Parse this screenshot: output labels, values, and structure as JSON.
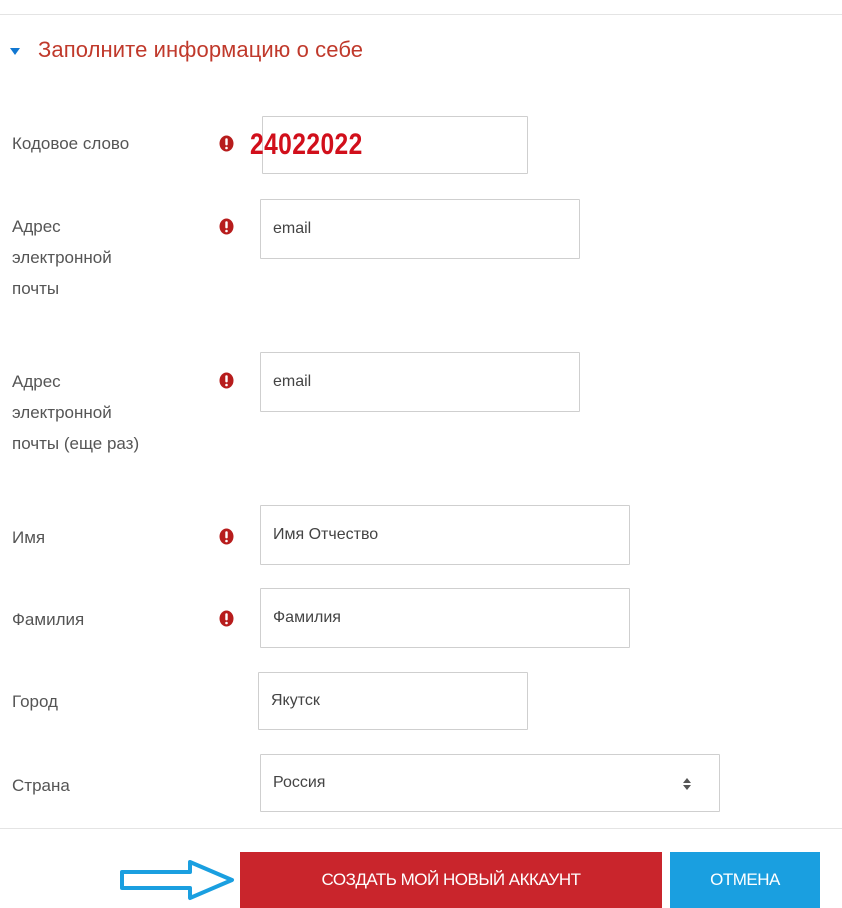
{
  "section": {
    "title": "Заполните информацию о себе"
  },
  "form": {
    "codeword": {
      "label": "Кодовое слово",
      "value": "24022022"
    },
    "email": {
      "label_lines": [
        "Адрес",
        "электронной",
        "почты"
      ],
      "value": "email"
    },
    "email_repeat": {
      "label_lines": [
        "Адрес",
        "электронной",
        "почты (еще раз)"
      ],
      "value": "email"
    },
    "first_name": {
      "label": "Имя",
      "value": "Имя Отчество"
    },
    "last_name": {
      "label": "Фамилия",
      "value": "Фамилия"
    },
    "city": {
      "label": "Город",
      "value": "Якутск"
    },
    "country": {
      "label": "Страна",
      "value": "Россия"
    }
  },
  "buttons": {
    "create_label": "СОЗДАТЬ МОЙ НОВЫЙ АККАУНТ",
    "cancel_label": "ОТМЕНА"
  },
  "colors": {
    "section_title": "#c0392b",
    "required_icon": "#b71c1c",
    "codeword": "#d10f1b",
    "create_button": "#c9252c",
    "cancel_button": "#1a9fe0",
    "arrow": "#1a9fe0"
  },
  "icons": {
    "collapse": "triangle-down-icon",
    "required": "exclamation-circle-icon",
    "select": "sort-arrows-icon",
    "pointer": "arrow-right-icon"
  }
}
